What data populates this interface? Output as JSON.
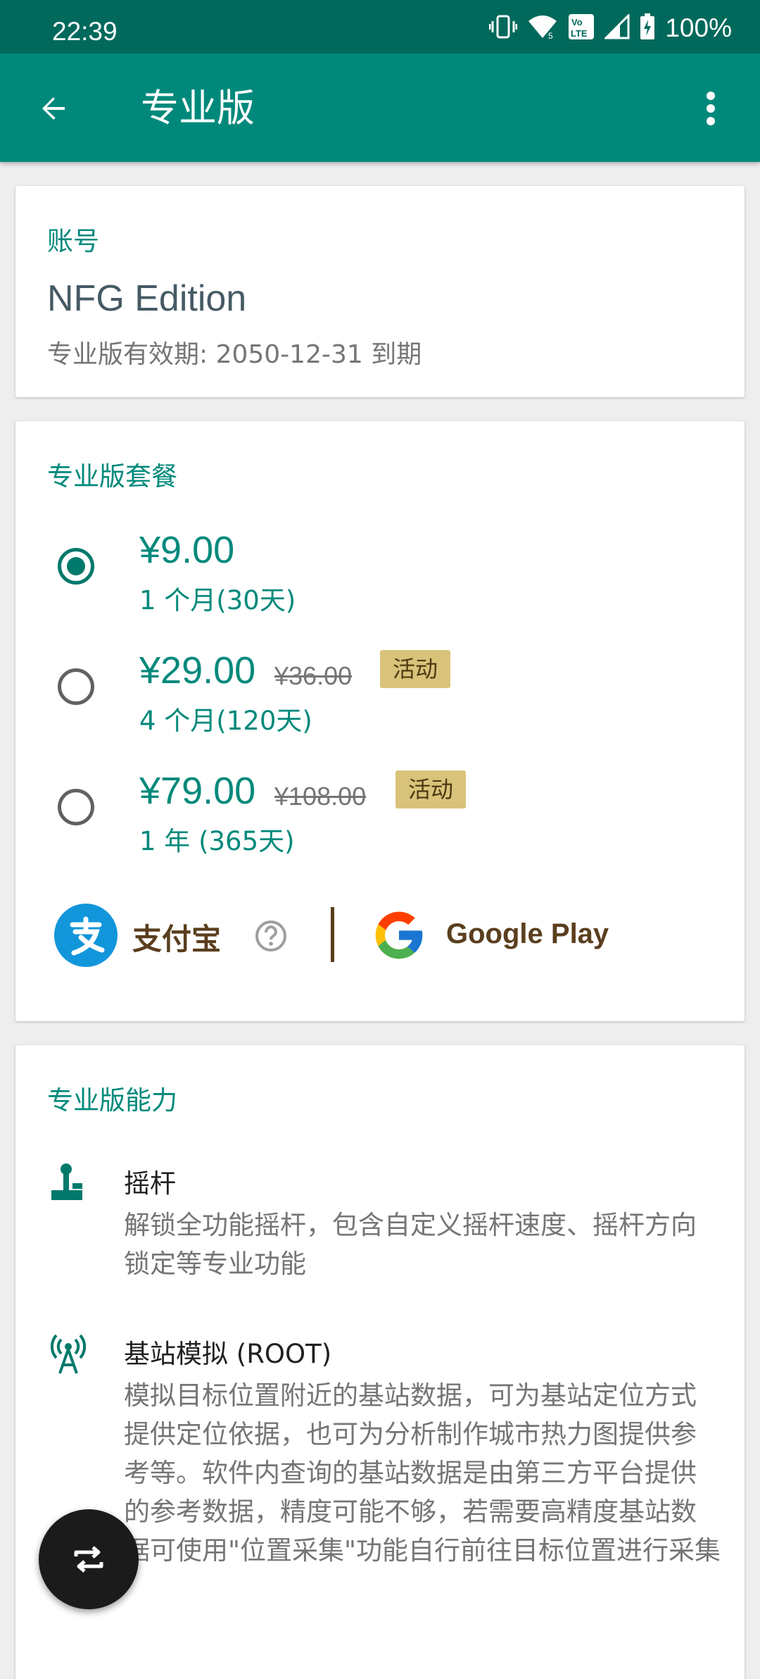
{
  "status_bar": {
    "time": "22:39",
    "battery": "100%",
    "icons": [
      "vibrate-icon",
      "wifi-icon",
      "volte-icon",
      "signal-icon",
      "battery-charging-icon"
    ]
  },
  "app_bar": {
    "title": "专业版",
    "back_icon": "arrow-back-icon",
    "more_icon": "more-vert-icon"
  },
  "account": {
    "section_title": "账号",
    "name": "NFG Edition",
    "expiry": "专业版有效期: 2050-12-31 到期"
  },
  "plans": {
    "section_title": "专业版套餐",
    "items": [
      {
        "price": "¥9.00",
        "original_price": "",
        "badge": "",
        "duration": "1 个月(30天)",
        "selected": true
      },
      {
        "price": "¥29.00",
        "original_price": "¥36.00",
        "badge": "活动",
        "duration": "4 个月(120天)",
        "selected": false
      },
      {
        "price": "¥79.00",
        "original_price": "¥108.00",
        "badge": "活动",
        "duration": "1 年 (365天)",
        "selected": false
      }
    ],
    "payment": {
      "alipay_label": "支付宝",
      "google_play_label": "Google Play"
    }
  },
  "features": {
    "section_title": "专业版能力",
    "items": [
      {
        "icon": "joystick-icon",
        "name": "摇杆",
        "desc": "解锁全功能摇杆，包含自定义摇杆速度、摇杆方向锁定等专业功能"
      },
      {
        "icon": "cell-tower-icon",
        "name": "基站模拟 (ROOT)",
        "desc": "模拟目标位置附近的基站数据，可为基站定位方式提供定位依据，也可为分析制作城市热力图提供参考等。软件内查询的基站数据是由第三方平台提供的参考数据，精度可能不够，若需要高精度基站数据可使用\"位置采集\"功能自行前往目标位置进行采集"
      }
    ]
  },
  "fab": {
    "icon": "swap-icon"
  },
  "colors": {
    "primary": "#00897b",
    "primary_dark": "#00695c",
    "badge": "#d9c37a",
    "payment_text": "#5a3e1e"
  }
}
